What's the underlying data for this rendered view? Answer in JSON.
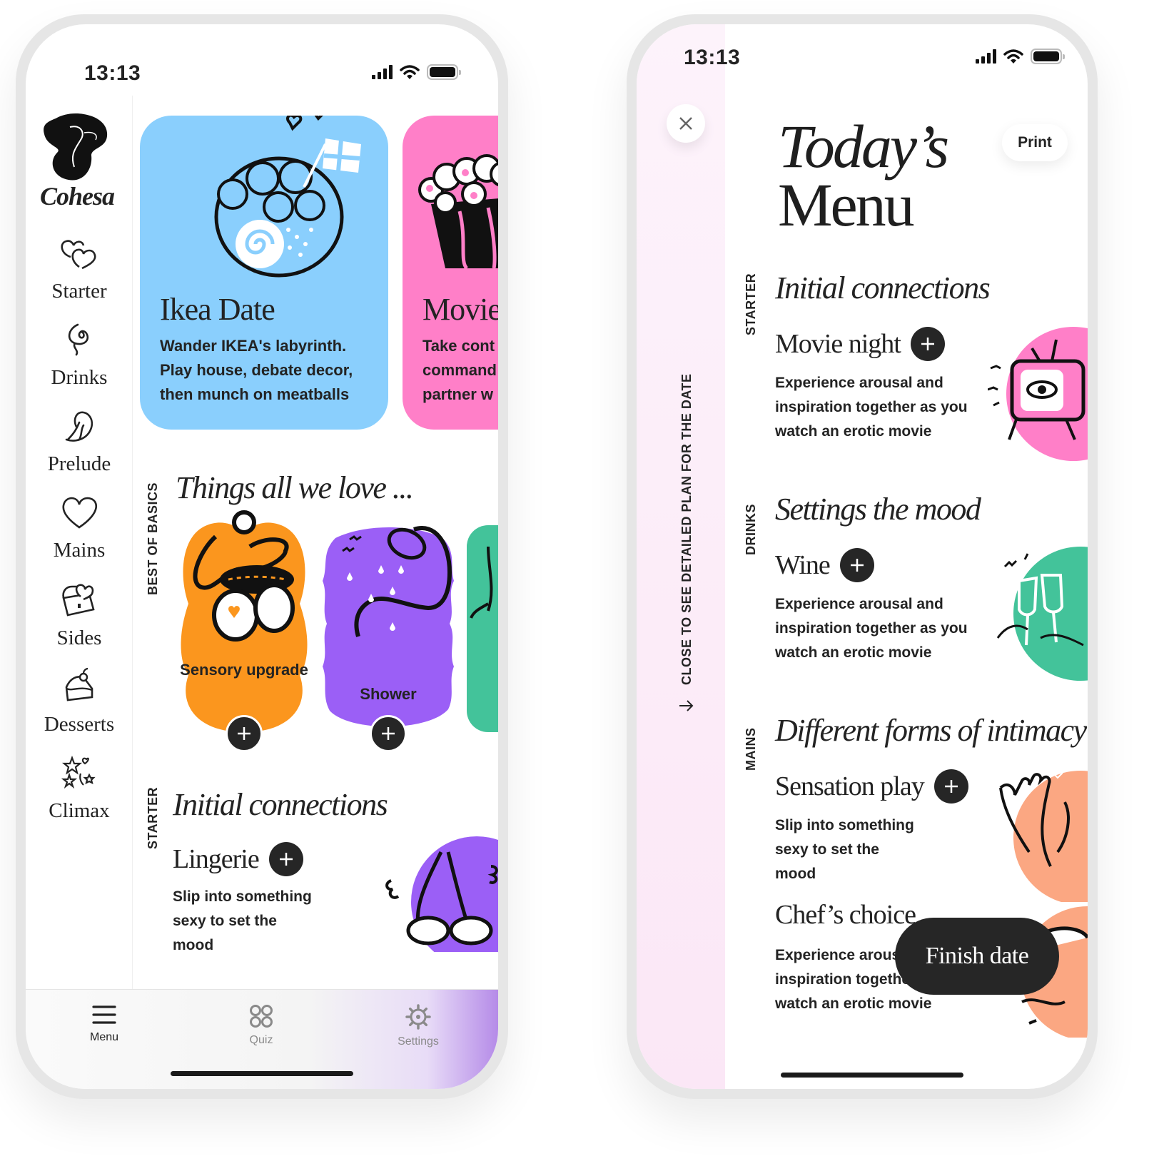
{
  "left_phone": {
    "status": {
      "time": "13:13"
    },
    "brand": {
      "name": "Cohesa"
    },
    "nav": [
      {
        "label": "Starter",
        "icon": "two-hearts-icon"
      },
      {
        "label": "Drinks",
        "icon": "swirl-icon"
      },
      {
        "label": "Prelude",
        "icon": "feather-icon"
      },
      {
        "label": "Mains",
        "icon": "heart-icon"
      },
      {
        "label": "Sides",
        "icon": "treasure-chest-icon"
      },
      {
        "label": "Desserts",
        "icon": "cake-icon"
      },
      {
        "label": "Climax",
        "icon": "fireworks-icon"
      }
    ],
    "hero_cards": [
      {
        "title": "Ikea Date",
        "desc": [
          "Wander IKEA's labyrinth.",
          "Play house, debate decor,",
          "then munch on meatballs"
        ],
        "color": "#8ACFFD"
      },
      {
        "title": "Movie",
        "desc": [
          "Take cont",
          "command",
          "partner w"
        ],
        "color": "#FF7FC8"
      }
    ],
    "basics": {
      "label": "BEST OF BASICS",
      "title": "Things all we love ...",
      "items": [
        {
          "label": "Sensory upgrade",
          "color": "#FB961E"
        },
        {
          "label": "Shower",
          "color": "#9B5FF6"
        },
        {
          "label": "",
          "color": "#43C39A"
        }
      ]
    },
    "starter": {
      "label": "STARTER",
      "title": "Initial connections",
      "item_title": "Lingerie",
      "item_desc": [
        "Slip into something",
        "sexy to set the",
        "mood"
      ],
      "color": "#9B5FF6"
    },
    "tabbar": [
      {
        "label": "Menu",
        "icon": "hamburger-icon",
        "active": true
      },
      {
        "label": "Quiz",
        "icon": "quiz-grid-icon",
        "active": false
      },
      {
        "label": "Settings",
        "icon": "gear-icon",
        "active": false
      }
    ]
  },
  "right_phone": {
    "status": {
      "time": "13:13"
    },
    "strip_label": "CLOSE TO SEE DETAILED PLAN FOR THE DATE",
    "title_line1": "Today’s",
    "title_line2": "Menu",
    "print_label": "Print",
    "sections": [
      {
        "label": "STARTER",
        "title": "Initial connections",
        "items": [
          {
            "title": "Movie night",
            "desc": [
              "Experience arousal and",
              "inspiration together as you",
              "watch an erotic movie"
            ],
            "color": "#FF7FC8",
            "icon": "tv-eye-icon"
          }
        ]
      },
      {
        "label": "DRINKS",
        "title": "Settings the mood",
        "items": [
          {
            "title": "Wine",
            "desc": [
              "Experience arousal and",
              "inspiration together as you",
              "watch an erotic movie"
            ],
            "color": "#43C39A",
            "icon": "wine-glasses-icon"
          }
        ]
      },
      {
        "label": "MAINS",
        "title": "Different forms of intimacy",
        "items": [
          {
            "title": "Sensation play",
            "desc": [
              "Slip into something",
              "sexy to set the",
              "mood"
            ],
            "color": "#FBA782",
            "icon": "hands-icon"
          },
          {
            "title": "Chef’s choice",
            "desc": [
              "Experience arousal and",
              "inspiration together as you",
              "watch an erotic movie"
            ],
            "color": "#FBA782",
            "icon": "cloche-icon"
          }
        ]
      }
    ],
    "finish_label": "Finish date"
  }
}
